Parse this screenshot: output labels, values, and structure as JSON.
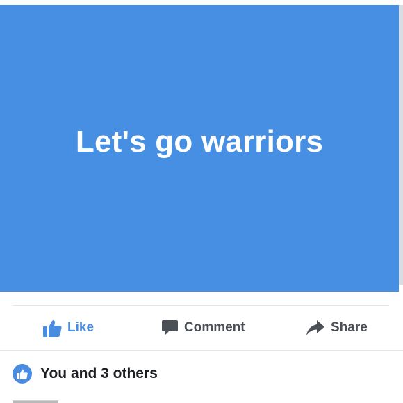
{
  "colors": {
    "post_background": "#468fe2",
    "accent": "#4a8de0",
    "action_text": "#4b4f56"
  },
  "post": {
    "text": "Let's go warriors"
  },
  "actions": {
    "like_label": "Like",
    "like_icon": "thumbs-up-icon",
    "comment_label": "Comment",
    "comment_icon": "speech-bubble-icon",
    "share_label": "Share",
    "share_icon": "share-arrow-icon"
  },
  "reactions": {
    "icon": "like-reaction-icon",
    "summary": "You and 3 others"
  }
}
